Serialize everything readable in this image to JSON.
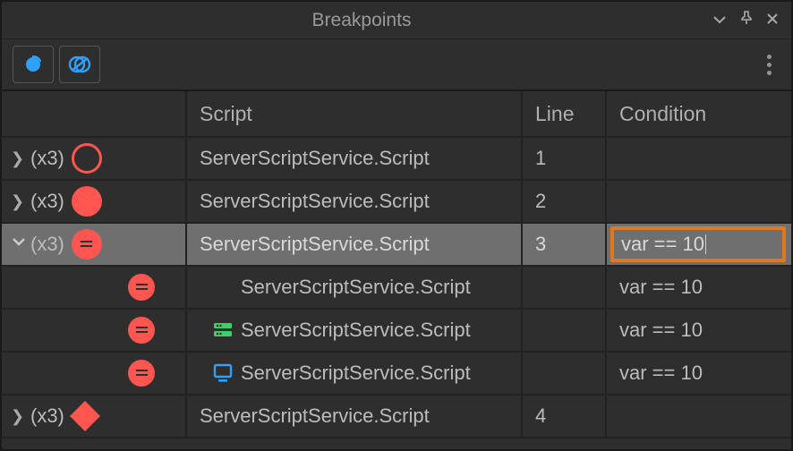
{
  "titlebar": {
    "title": "Breakpoints"
  },
  "columns": {
    "tree": "",
    "script": "Script",
    "line": "Line",
    "condition": "Condition"
  },
  "rows": [
    {
      "expanded": false,
      "count": "(x3)",
      "type": "open-circle",
      "script": "ServerScriptService.Script",
      "line": "1",
      "condition": "",
      "selected": false
    },
    {
      "expanded": false,
      "count": "(x3)",
      "type": "solid-circle",
      "script": "ServerScriptService.Script",
      "line": "2",
      "condition": "",
      "selected": false
    },
    {
      "expanded": true,
      "count": "(x3)",
      "type": "equal-circle",
      "script": "ServerScriptService.Script",
      "line": "3",
      "condition": "var == 10",
      "selected": true,
      "editing": true,
      "children": [
        {
          "type": "equal-circle",
          "context": "none",
          "script": "ServerScriptService.Script",
          "line": "",
          "condition": "var == 10"
        },
        {
          "type": "equal-circle",
          "context": "server",
          "script": "ServerScriptService.Script",
          "line": "",
          "condition": "var == 10"
        },
        {
          "type": "equal-circle",
          "context": "client",
          "script": "ServerScriptService.Script",
          "line": "",
          "condition": "var == 10"
        }
      ]
    },
    {
      "expanded": false,
      "count": "(x3)",
      "type": "diamond",
      "script": "ServerScriptService.Script",
      "line": "4",
      "condition": "",
      "selected": false
    }
  ],
  "glyphs": {
    "chevron_right": "❯",
    "chevron_down": "⌄",
    "minimize": "⌄",
    "pin": "📌",
    "close": "✕"
  },
  "colors": {
    "breakpoint": "#ff564f",
    "toolbarBlue": "#2ea0ff",
    "serverGreen": "#3fcf6a",
    "editHighlight": "#e0781e"
  }
}
